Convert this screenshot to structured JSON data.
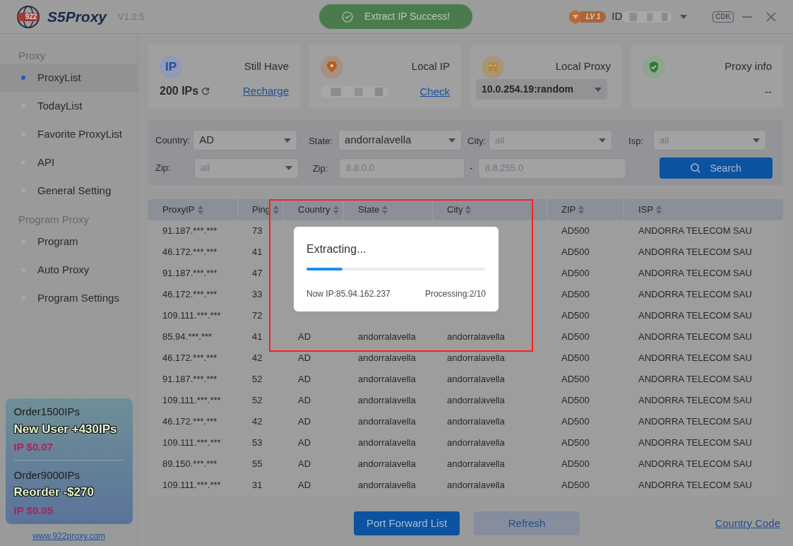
{
  "header": {
    "logo_badge": "922",
    "logo_text": "S5Proxy",
    "version": "V1.2.5",
    "toast": "Extract IP Success!",
    "level_badge": "LV 1",
    "id_label": "ID",
    "cdk": "CDK"
  },
  "stats": [
    {
      "kind": "ip",
      "icon_text": "IP",
      "title": "Still Have",
      "value": "200 IPs",
      "link": "Recharge"
    },
    {
      "kind": "local_ip",
      "title": "Local IP",
      "link": "Check"
    },
    {
      "kind": "local_proxy",
      "title": "Local Proxy",
      "select": "10.0.254.19:random"
    },
    {
      "kind": "info",
      "title": "Proxy info",
      "value": "--"
    }
  ],
  "sidebar": {
    "sections": [
      {
        "title": "Proxy",
        "items": [
          {
            "label": "ProxyList",
            "selected": true
          },
          {
            "label": "TodayList",
            "selected": false
          },
          {
            "label": "Favorite ProxyList",
            "selected": false
          },
          {
            "label": "API",
            "selected": false
          },
          {
            "label": "General Setting",
            "selected": false
          }
        ]
      },
      {
        "title": "Program Proxy",
        "items": [
          {
            "label": "Program",
            "selected": false
          },
          {
            "label": "Auto Proxy",
            "selected": false
          },
          {
            "label": "Program Settings",
            "selected": false
          }
        ]
      }
    ],
    "promo": [
      {
        "order": "Order1500IPs",
        "headline": "New User +430IPs",
        "price": "IP $0.07"
      },
      {
        "order": "Order9000IPs",
        "headline": "Reorder -$270",
        "price": "IP $0.05"
      }
    ],
    "website": "www.922proxy.com"
  },
  "filters": {
    "country": {
      "label": "Country:",
      "value": "AD"
    },
    "state": {
      "label": "State:",
      "value": "andorralavella"
    },
    "city": {
      "label": "City:",
      "placeholder": "all"
    },
    "isp": {
      "label": "Isp:",
      "placeholder": "all"
    },
    "zip_select": {
      "label": "Zip:",
      "placeholder": "all"
    },
    "zip_range": {
      "label": "Zip:",
      "from": "8.8.0.0",
      "separator": "-",
      "to": "8.8.255.0"
    },
    "search": "Search"
  },
  "table": {
    "columns": [
      "ProxyIP",
      "Ping",
      "Country",
      "State",
      "City",
      "ZIP",
      "ISP"
    ],
    "rows": [
      {
        "proxy_ip": "91.187.***.***",
        "ping": "73",
        "zip": "AD500",
        "isp": "ANDORRA TELECOM SAU"
      },
      {
        "proxy_ip": "46.172.***.***",
        "ping": "41",
        "zip": "AD500",
        "isp": "ANDORRA TELECOM SAU"
      },
      {
        "proxy_ip": "91.187.***.***",
        "ping": "47",
        "zip": "AD500",
        "isp": "ANDORRA TELECOM SAU"
      },
      {
        "proxy_ip": "46.172.***.***",
        "ping": "33",
        "zip": "AD500",
        "isp": "ANDORRA TELECOM SAU"
      },
      {
        "proxy_ip": "109.111.***.***",
        "ping": "72",
        "zip": "AD500",
        "isp": "ANDORRA TELECOM SAU"
      },
      {
        "proxy_ip": "85.94.***.***",
        "ping": "41",
        "country": "AD",
        "state": "andorralavella",
        "city": "andorralavella",
        "zip": "AD500",
        "isp": "ANDORRA TELECOM SAU"
      },
      {
        "proxy_ip": "46.172.***.***",
        "ping": "42",
        "country": "AD",
        "state": "andorralavella",
        "city": "andorralavella",
        "zip": "AD500",
        "isp": "ANDORRA TELECOM SAU"
      },
      {
        "proxy_ip": "91.187.***.***",
        "ping": "52",
        "country": "AD",
        "state": "andorralavella",
        "city": "andorralavella",
        "zip": "AD500",
        "isp": "ANDORRA TELECOM SAU"
      },
      {
        "proxy_ip": "109.111.***.***",
        "ping": "52",
        "country": "AD",
        "state": "andorralavella",
        "city": "andorralavella",
        "zip": "AD500",
        "isp": "ANDORRA TELECOM SAU"
      },
      {
        "proxy_ip": "46.172.***.***",
        "ping": "42",
        "country": "AD",
        "state": "andorralavella",
        "city": "andorralavella",
        "zip": "AD500",
        "isp": "ANDORRA TELECOM SAU"
      },
      {
        "proxy_ip": "109.111.***.***",
        "ping": "53",
        "country": "AD",
        "state": "andorralavella",
        "city": "andorralavella",
        "zip": "AD500",
        "isp": "ANDORRA TELECOM SAU"
      },
      {
        "proxy_ip": "89.150.***.***",
        "ping": "55",
        "country": "AD",
        "state": "andorralavella",
        "city": "andorralavella",
        "zip": "AD500",
        "isp": "ANDORRA TELECOM SAU"
      },
      {
        "proxy_ip": "109.111.***.***",
        "ping": "31",
        "country": "AD",
        "state": "andorralavella",
        "city": "andorralavella",
        "zip": "AD500",
        "isp": "ANDORRA TELECOM SAU"
      }
    ]
  },
  "footer": {
    "buttons": [
      {
        "label": "Port Forward List",
        "kind": "primary"
      },
      {
        "label": "Refresh",
        "kind": "secondary"
      }
    ],
    "link": "Country Code"
  },
  "modal": {
    "title": "Extracting...",
    "level": 0.2,
    "now_ip": "Now IP:85.94.162.237",
    "processing": "Processing:2/10"
  }
}
